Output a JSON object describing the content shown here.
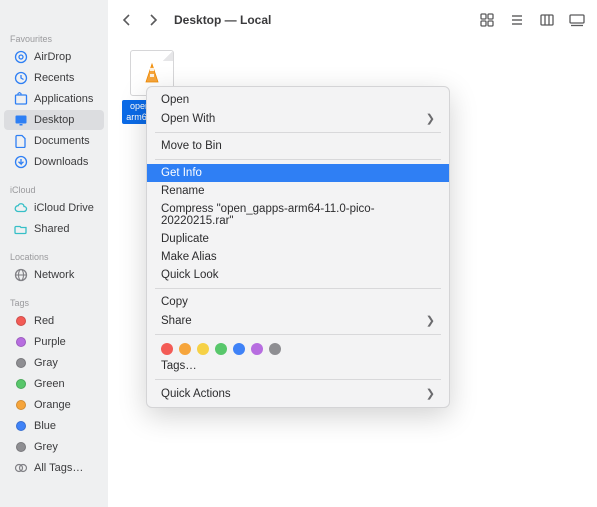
{
  "toolbar": {
    "title": "Desktop — Local"
  },
  "sidebar": {
    "sections": [
      {
        "heading": "Favourites",
        "items": [
          {
            "label": "AirDrop",
            "icon": "airdrop",
            "selected": false
          },
          {
            "label": "Recents",
            "icon": "clock",
            "selected": false
          },
          {
            "label": "Applications",
            "icon": "apps",
            "selected": false
          },
          {
            "label": "Desktop",
            "icon": "desktop",
            "selected": true
          },
          {
            "label": "Documents",
            "icon": "documents",
            "selected": false
          },
          {
            "label": "Downloads",
            "icon": "downloads",
            "selected": false
          }
        ]
      },
      {
        "heading": "iCloud",
        "items": [
          {
            "label": "iCloud Drive",
            "icon": "cloud",
            "selected": false
          },
          {
            "label": "Shared",
            "icon": "shared",
            "selected": false
          }
        ]
      },
      {
        "heading": "Locations",
        "items": [
          {
            "label": "Network",
            "icon": "network",
            "selected": false
          }
        ]
      },
      {
        "heading": "Tags",
        "items": [
          {
            "label": "Red",
            "tag": "#f35b56"
          },
          {
            "label": "Purple",
            "tag": "#b76de0"
          },
          {
            "label": "Gray",
            "tag": "#8e8e92"
          },
          {
            "label": "Green",
            "tag": "#58c76b"
          },
          {
            "label": "Orange",
            "tag": "#f6a53c"
          },
          {
            "label": "Blue",
            "tag": "#3f82f7"
          },
          {
            "label": "Grey",
            "tag": "#8e8e92"
          },
          {
            "label": "All Tags…",
            "icon": "alltags"
          }
        ]
      }
    ]
  },
  "file": {
    "name_line1": "open_ga…",
    "name_line2": "arm64-…0…"
  },
  "ctx": {
    "open": "Open",
    "open_with": "Open With",
    "move_to_bin": "Move to Bin",
    "get_info": "Get Info",
    "rename": "Rename",
    "compress": "Compress \"open_gapps-arm64-11.0-pico-20220215.rar\"",
    "duplicate": "Duplicate",
    "make_alias": "Make Alias",
    "quick_look": "Quick Look",
    "copy": "Copy",
    "share": "Share",
    "tags": "Tags…",
    "quick_actions": "Quick Actions",
    "tag_colors": [
      "#f35b56",
      "#f6a53c",
      "#f6d146",
      "#58c76b",
      "#3f82f7",
      "#b76de0",
      "#8e8e92"
    ]
  }
}
